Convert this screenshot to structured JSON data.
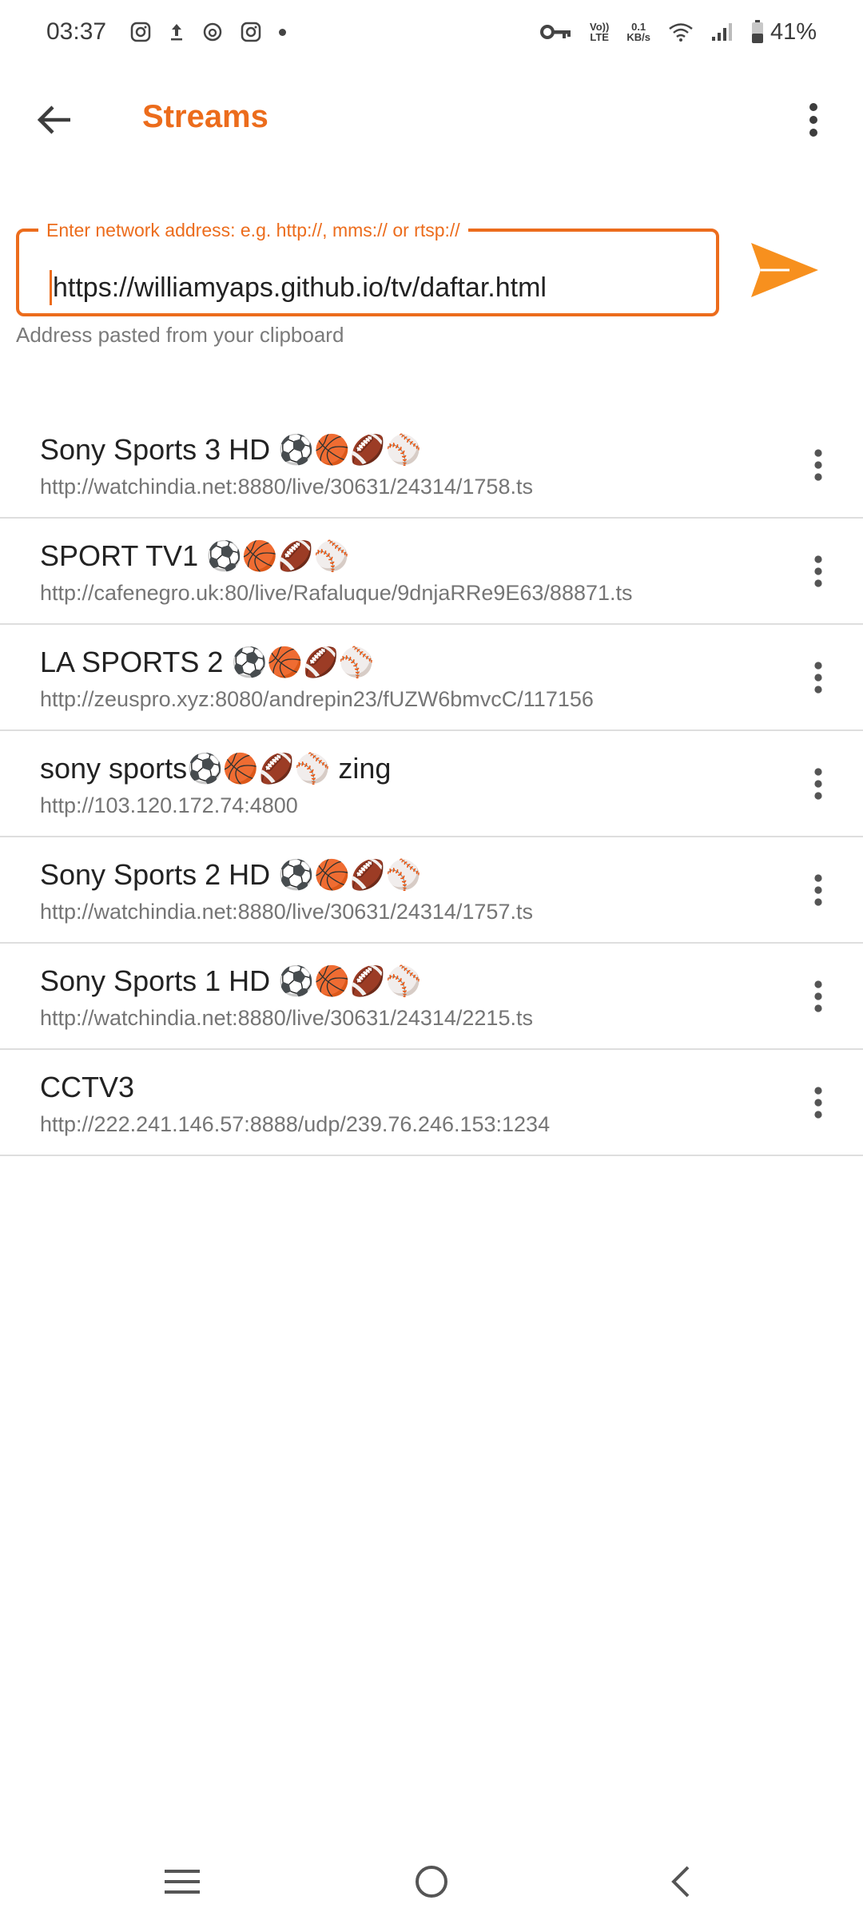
{
  "status_bar": {
    "time": "03:37",
    "net_speed_value": "0.1",
    "net_speed_unit": "KB/s",
    "volte_top": "Vo))",
    "volte_bottom": "LTE",
    "battery": "41%"
  },
  "app_bar": {
    "title": "Streams"
  },
  "address": {
    "label": "Enter network address: e.g. http://, mms:// or rtsp://",
    "value": "https://williamyaps.github.io/tv/daftar.html",
    "helper": "Address pasted from your clipboard"
  },
  "streams": [
    {
      "title": "Sony Sports 3 HD ⚽🏀🏈⚾",
      "url": "http://watchindia.net:8880/live/30631/24314/1758.ts"
    },
    {
      "title": "SPORT TV1 ⚽🏀🏈⚾",
      "url": "http://cafenegro.uk:80/live/Rafaluque/9dnjaRRe9E63/88871.ts"
    },
    {
      "title": "LA SPORTS 2 ⚽🏀🏈⚾",
      "url": "http://zeuspro.xyz:8080/andrepin23/fUZW6bmvcC/117156"
    },
    {
      "title": "sony sports⚽🏀🏈⚾ zing",
      "url": "http://103.120.172.74:4800"
    },
    {
      "title": "Sony Sports 2 HD ⚽🏀🏈⚾",
      "url": "http://watchindia.net:8880/live/30631/24314/1757.ts"
    },
    {
      "title": "Sony Sports 1 HD ⚽🏀🏈⚾",
      "url": "http://watchindia.net:8880/live/30631/24314/2215.ts"
    },
    {
      "title": "CCTV3",
      "url": "http://222.241.146.57:8888/udp/239.76.246.153:1234"
    }
  ],
  "colors": {
    "accent": "#ec6c1c",
    "send": "#f7901e"
  }
}
